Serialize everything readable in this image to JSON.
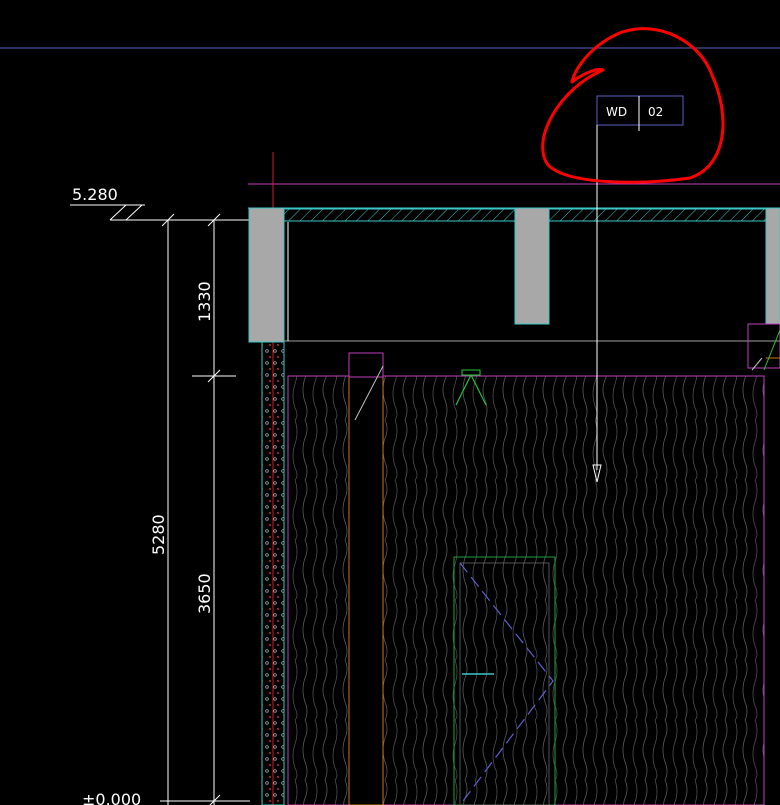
{
  "elevation_marks": {
    "top": "5.280",
    "bottom": "±0.000"
  },
  "dimensions": {
    "overall": "5280",
    "upper": "1330",
    "lower": "3650"
  },
  "callout_tag": {
    "code": "WD",
    "number": "02"
  },
  "annotation": {
    "color": "#ff0000",
    "shape": "hand-drawn circle around tag"
  },
  "colors": {
    "background": "#000000",
    "outline_cyan": "#3cc8c8",
    "magenta": "#c040c0",
    "gray_fill": "#a8a8a8",
    "orange": "#c87820",
    "green": "#20c840",
    "purple_line": "#6060c0"
  }
}
